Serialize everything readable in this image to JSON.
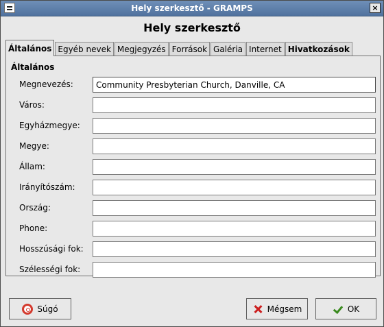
{
  "window": {
    "title": "Hely szerkesztő - GRAMPS",
    "heading": "Hely szerkesztő"
  },
  "tabs": [
    {
      "label": "Általános",
      "active": true
    },
    {
      "label": "Egyéb nevek"
    },
    {
      "label": "Megjegyzés"
    },
    {
      "label": "Források"
    },
    {
      "label": "Galéria"
    },
    {
      "label": "Internet"
    },
    {
      "label": "Hivatkozások",
      "bold": true
    }
  ],
  "section": {
    "title": "Általános"
  },
  "fields": [
    {
      "label": "Megnevezés:",
      "value": "Community Presbyterian Church, Danville, CA"
    },
    {
      "label": "Város:",
      "value": ""
    },
    {
      "label": "Egyházmegye:",
      "value": ""
    },
    {
      "label": "Megye:",
      "value": ""
    },
    {
      "label": "Állam:",
      "value": ""
    },
    {
      "label": "Irányítószám:",
      "value": ""
    },
    {
      "label": "Ország:",
      "value": ""
    },
    {
      "label": "Phone:",
      "value": ""
    },
    {
      "label": "Hosszúsági fok:",
      "value": ""
    },
    {
      "label": "Szélességi fok:",
      "value": ""
    }
  ],
  "buttons": {
    "help": "Súgó",
    "cancel": "Mégsem",
    "ok": "OK"
  },
  "icons": {
    "help": "lifebuoy-icon",
    "cancel": "x-icon",
    "ok": "checkmark-icon"
  }
}
